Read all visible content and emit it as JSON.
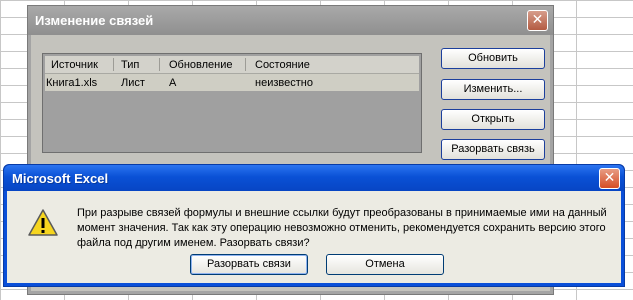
{
  "links_dialog": {
    "title": "Изменение связей",
    "columns": [
      "Источник",
      "Тип",
      "Обновление",
      "Состояние"
    ],
    "row": {
      "source": "Книга1.xls",
      "type": "Лист",
      "update": "А",
      "status": "неизвестно"
    },
    "buttons": {
      "update": "Обновить",
      "change": "Изменить...",
      "open": "Открыть",
      "break": "Разорвать связь"
    }
  },
  "message_box": {
    "title": "Microsoft Excel",
    "text": "При разрыве связей формулы и внешние ссылки будут преобразованы в принимаемые ими на данный момент значения. Так как эту операцию невозможно отменить, рекомендуется сохранить версию этого файла под другим именем. Разорвать связи?",
    "buttons": {
      "break_links": "Разорвать связи",
      "cancel": "Отмена"
    },
    "icon": "warning-icon"
  },
  "colors": {
    "xp_blue": "#0a4fd9",
    "close_red": "#d64d24",
    "dialog_face": "#ecebe3"
  }
}
